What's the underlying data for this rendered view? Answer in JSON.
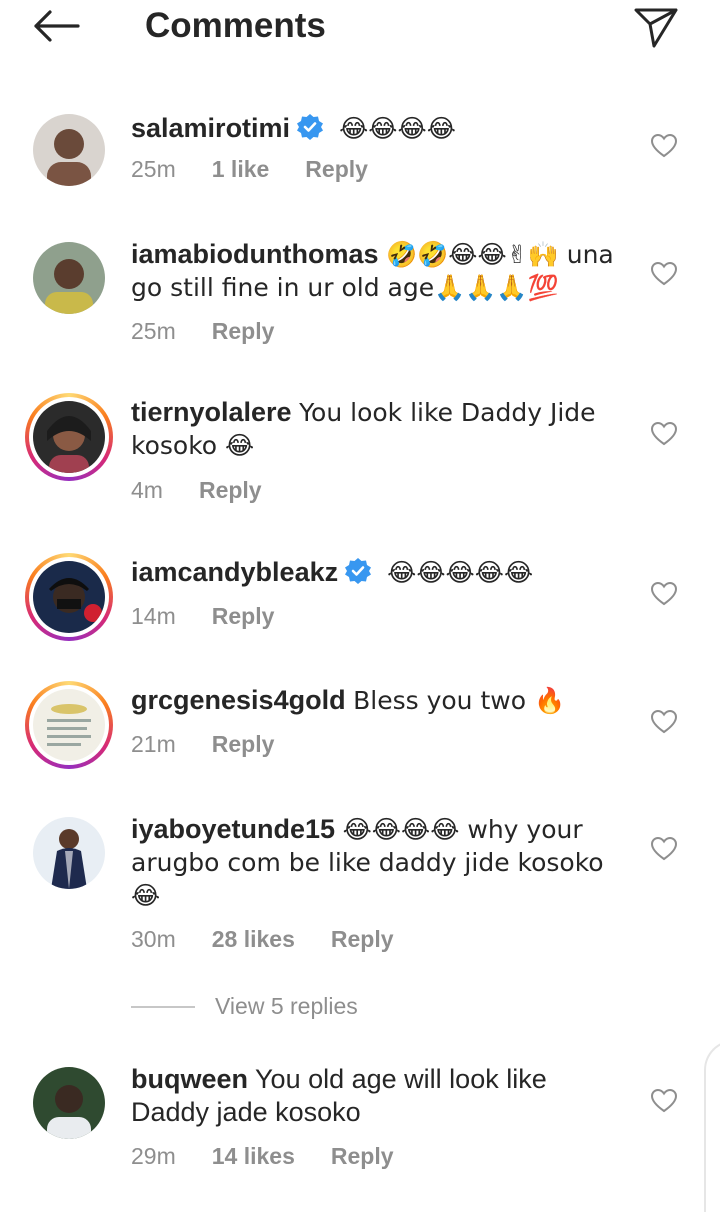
{
  "header": {
    "title": "Comments",
    "back_icon": "arrow-left-icon",
    "send_icon": "paper-plane-icon"
  },
  "colors": {
    "verified": "#3897f0",
    "meta": "#8e8e8e",
    "text": "#262626"
  },
  "comments": [
    {
      "username": "salamirotimi",
      "verified": true,
      "text": "😂😂😂😂",
      "time": "25m",
      "likes": "1 like",
      "reply": "Reply"
    },
    {
      "username": "iamabiodunthomas",
      "verified": false,
      "text": "🤣🤣😂😂✌🙌 una go still fine in ur old age🙏🙏🙏💯",
      "time": "25m",
      "likes": "",
      "reply": "Reply"
    },
    {
      "username": "tiernyolalere",
      "verified": false,
      "text": "You look like Daddy Jide kosoko 😂",
      "time": "4m",
      "likes": "",
      "reply": "Reply"
    },
    {
      "username": "iamcandybleakz",
      "verified": true,
      "text": "😂😂😂😂😂",
      "time": "14m",
      "likes": "",
      "reply": "Reply"
    },
    {
      "username": "grcgenesis4gold",
      "verified": false,
      "text": "Bless you two 🔥",
      "time": "21m",
      "likes": "",
      "reply": "Reply"
    },
    {
      "username": "iyaboyetunde15",
      "verified": false,
      "text": "😂😂😂😂 why your arugbo com be like daddy jide kosoko 😂",
      "time": "30m",
      "likes": "28 likes",
      "reply": "Reply"
    },
    {
      "username": "buqween",
      "verified": false,
      "text": "You old age will look like Daddy jade kosoko",
      "time": "29m",
      "likes": "14 likes",
      "reply": "Reply"
    }
  ],
  "view_replies": "View 5 replies"
}
